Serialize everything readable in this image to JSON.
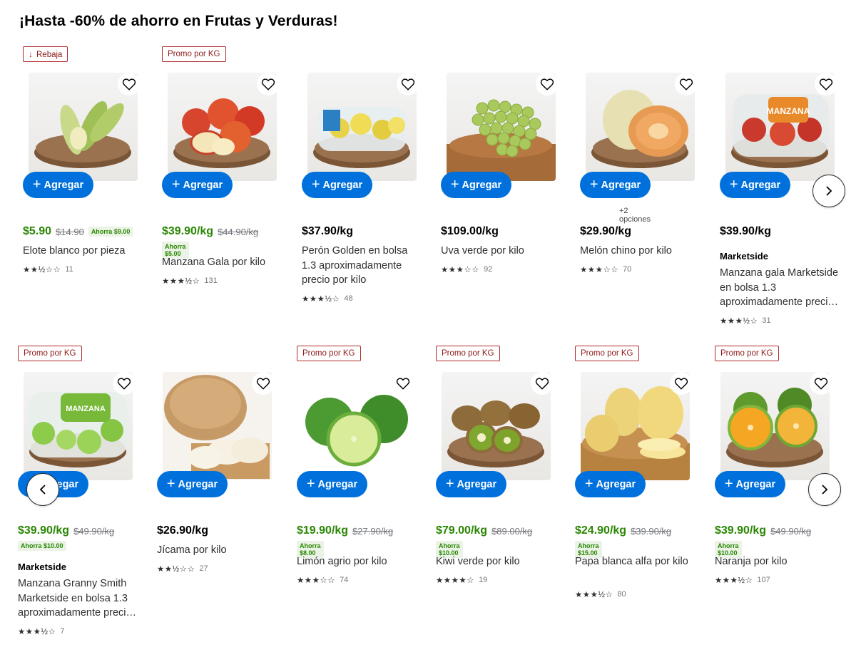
{
  "title": "¡Hasta -60% de ahorro en Frutas y Verduras!",
  "add_label": "Agregar",
  "nav_prev_icon": "chevron-left-icon",
  "nav_next_icon": "chevron-right-icon",
  "colors": {
    "accent": "#0071dc",
    "price_green": "#2a8703",
    "badge_red": "#b12a2a"
  },
  "row1": [
    {
      "badge": "Rebaja",
      "badge_icon": "arrow-down-icon",
      "price": "$5.90",
      "old_price": "$14.90",
      "save": "Ahorra $9.00",
      "save_inline": true,
      "name": "Elote blanco por pieza",
      "stars": "★★½☆☆",
      "rating_count": "11",
      "image": "corn"
    },
    {
      "badge": "Promo por KG",
      "price": "$39.90/kg",
      "old_price": "$44.90/kg",
      "save": "Ahorra $5.00",
      "name": "Manzana Gala por kilo",
      "stars": "★★★½☆",
      "rating_count": "131",
      "image": "apples"
    },
    {
      "price": "$37.90/kg",
      "name": "Perón Golden en bolsa 1.3 aproximadamente precio por kilo",
      "stars": "★★★½☆",
      "rating_count": "48",
      "image": "golden-bag"
    },
    {
      "price": "$109.00/kg",
      "name": "Uva verde por kilo",
      "stars": "★★★☆☆",
      "rating_count": "92",
      "image": "grapes"
    },
    {
      "price": "$29.90/kg",
      "options": "+2 opciones",
      "name": "Melón chino por kilo",
      "stars": "★★★☆☆",
      "rating_count": "70",
      "image": "melon"
    },
    {
      "price": "$39.90/kg",
      "brand": "Marketside",
      "name": "Manzana gala Marketside en bolsa 1.3 aproximadamente preci…",
      "stars": "★★★½☆",
      "rating_count": "31",
      "image": "gala-bag"
    }
  ],
  "row2": [
    {
      "badge": "Promo por KG",
      "price": "$39.90/kg",
      "old_price": "$49.90/kg",
      "save": "Ahorra $10.00",
      "brand": "Marketside",
      "name": "Manzana Granny Smith Marketside en bolsa 1.3 aproximadamente preci…",
      "stars": "★★★½☆",
      "rating_count": "7",
      "image": "granny-bag"
    },
    {
      "price": "$26.90/kg",
      "name": "Jícama por kilo",
      "stars": "★★½☆☆",
      "rating_count": "27",
      "image": "jicama"
    },
    {
      "badge": "Promo por KG",
      "price": "$19.90/kg",
      "old_price": "$27.90/kg",
      "save": "Ahorra $8.00",
      "name": "Limón agrio por kilo",
      "stars": "★★★☆☆",
      "rating_count": "74",
      "image": "limes"
    },
    {
      "badge": "Promo por KG",
      "price": "$79.00/kg",
      "old_price": "$89.00/kg",
      "save": "Ahorra $10.00",
      "name": "Kiwi verde por kilo",
      "stars": "★★★★☆",
      "rating_count": "19",
      "image": "kiwi"
    },
    {
      "badge": "Promo por KG",
      "price": "$24.90/kg",
      "old_price": "$39.90/kg",
      "save": "Ahorra $15.00",
      "name": "Papa blanca alfa por kilo",
      "stars": "★★★½☆",
      "rating_count": "80",
      "image": "potatoes"
    },
    {
      "badge": "Promo por KG",
      "price": "$39.90/kg",
      "old_price": "$49.90/kg",
      "save": "Ahorra $10.00",
      "name": "Naranja por kilo",
      "stars": "★★★½☆",
      "rating_count": "107",
      "image": "oranges"
    }
  ]
}
